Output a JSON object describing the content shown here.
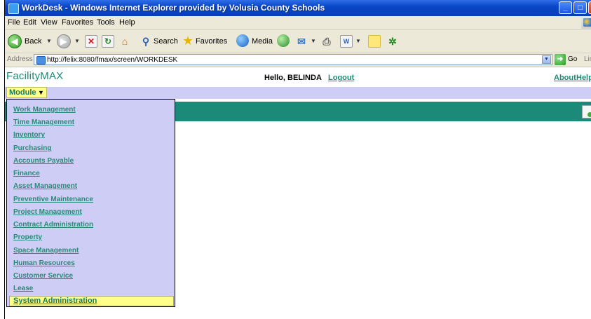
{
  "window": {
    "title": "WorkDesk - Windows Internet Explorer provided by Volusia County Schools",
    "minimize": "_",
    "maximize": "□",
    "close": "X"
  },
  "menu": {
    "file": "File",
    "edit": "Edit",
    "view": "View",
    "favorites": "Favorites",
    "tools": "Tools",
    "help": "Help"
  },
  "toolbar": {
    "back": "Back",
    "search": "Search",
    "favorites": "Favorites",
    "media": "Media"
  },
  "address": {
    "label": "Address",
    "url": "http://felix:8080/fmax/screen/WORKDESK",
    "go": "Go",
    "links": "Lin"
  },
  "app": {
    "brand": "FacilityMAX",
    "greeting": "Hello, BELINDA",
    "logout": "Logout",
    "about": "About",
    "help": "Help"
  },
  "module": {
    "button_label": "Module",
    "items": [
      {
        "label": "Work Management"
      },
      {
        "label": "Time Management"
      },
      {
        "label": "Inventory"
      },
      {
        "label": "Purchasing"
      },
      {
        "label": "Accounts Payable"
      },
      {
        "label": "Finance"
      },
      {
        "label": "Asset Management"
      },
      {
        "label": "Preventive Maintenance"
      },
      {
        "label": "Project Management"
      },
      {
        "label": "Contract Administration"
      },
      {
        "label": "Property"
      },
      {
        "label": "Space Management"
      },
      {
        "label": "Human Resources"
      },
      {
        "label": "Customer Service"
      },
      {
        "label": "Lease"
      },
      {
        "label": "System Administration",
        "selected": true
      }
    ]
  }
}
